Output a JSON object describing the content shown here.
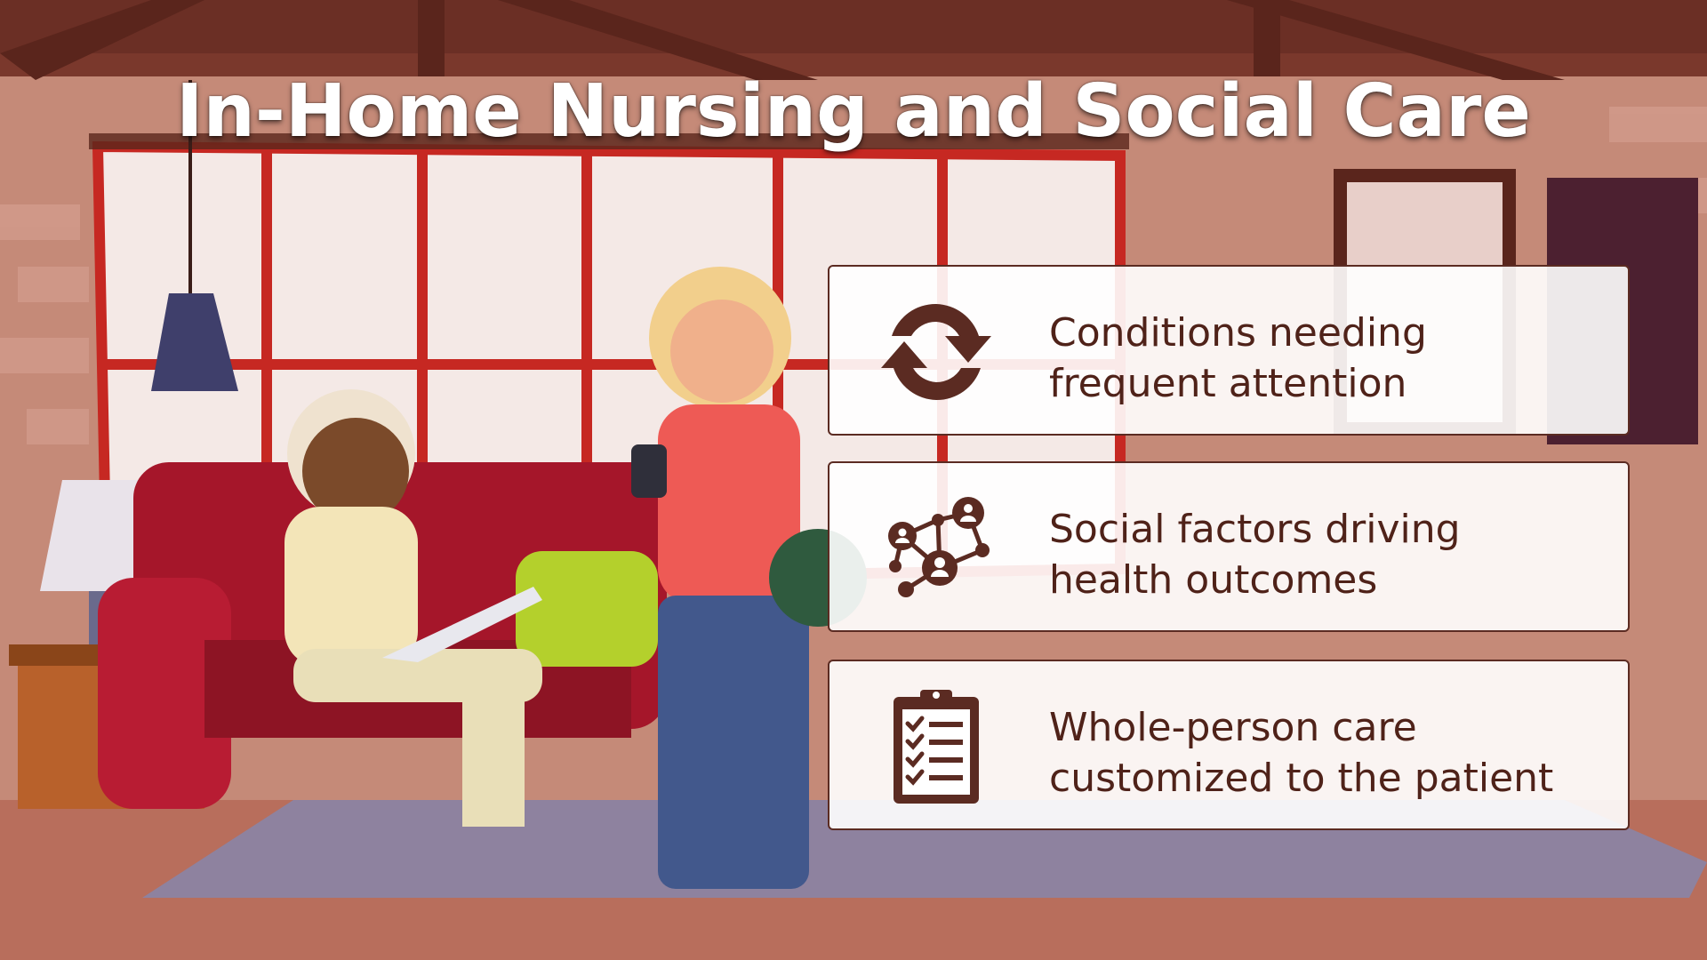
{
  "title": "In-Home Nursing and Social Care",
  "colors": {
    "accent": "#5b2b22",
    "text": "#4f2219",
    "card_bg": "#ffffff"
  },
  "cards": [
    {
      "icon": "refresh-cycle-icon",
      "text": "Conditions needing\nfrequent attention"
    },
    {
      "icon": "social-network-icon",
      "text": "Social factors driving\nhealth outcomes"
    },
    {
      "icon": "clipboard-checklist-icon",
      "text": "Whole-person care\ncustomized to the patient"
    }
  ]
}
